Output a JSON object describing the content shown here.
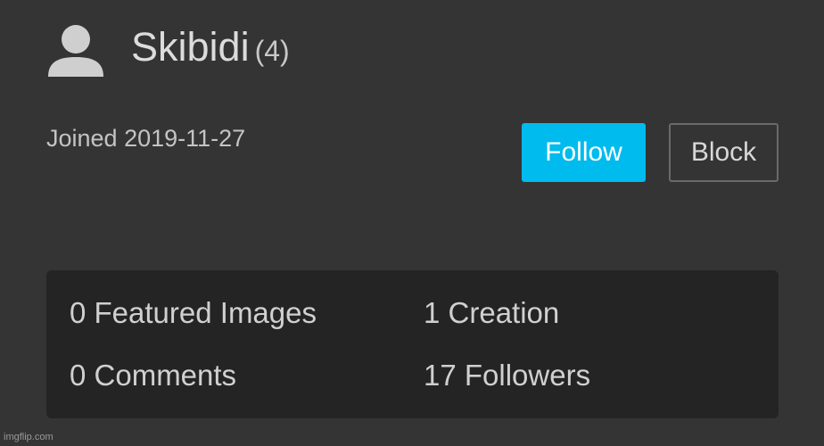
{
  "profile": {
    "username": "Skibidi",
    "points": "(4)",
    "joined": "Joined 2019-11-27",
    "avatar_icon": "user-silhouette-icon"
  },
  "actions": {
    "follow_label": "Follow",
    "block_label": "Block",
    "follow_color": "#00bbee"
  },
  "stats": {
    "featured_images": "0 Featured Images",
    "creations": "1 Creation",
    "comments": "0 Comments",
    "followers": "17 Followers"
  },
  "watermark": "imgflip.com"
}
